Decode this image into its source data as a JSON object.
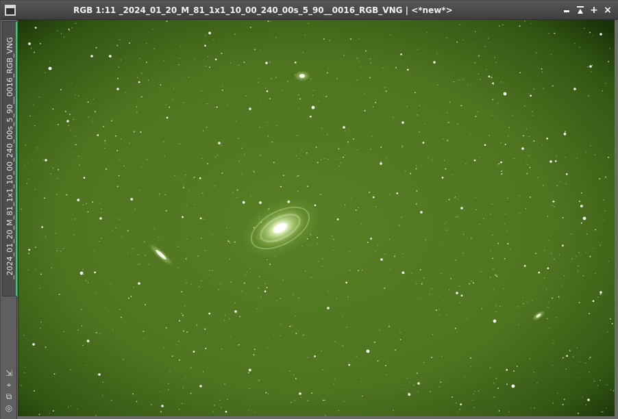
{
  "window": {
    "title": "RGB 1:11 _2024_01_20_M_81_1x1_10_00_240_00s_5_90__0016_RGB_VNG | <*new*>",
    "side_tab_label": "_2024_01_20_M_81_1x1_10_00_240_00s_5_90__0016_RGB_VNG",
    "accent_color": "#27d36a",
    "controls": {
      "minimize_icon": "minimize-icon",
      "shade_icon": "shade-icon",
      "maximize_icon": "plus-icon",
      "close_icon": "close-icon"
    }
  },
  "side_tools": [
    {
      "icon": "fit-view-icon",
      "symbol": "⇲"
    },
    {
      "icon": "zoom-icon",
      "symbol": "⌖"
    },
    {
      "icon": "clone-icon",
      "symbol": "⧉"
    },
    {
      "icon": "target-icon",
      "symbol": "◎"
    }
  ],
  "image": {
    "background_color": "#4f7420",
    "vignette_color": "#173208",
    "features": [
      {
        "name": "galaxy-main",
        "type": "spiral-galaxy"
      },
      {
        "name": "galaxy-left",
        "type": "edge-on-galaxy"
      },
      {
        "name": "galaxy-top",
        "type": "small-galaxy"
      },
      {
        "name": "galaxy-right",
        "type": "small-galaxy"
      }
    ]
  }
}
